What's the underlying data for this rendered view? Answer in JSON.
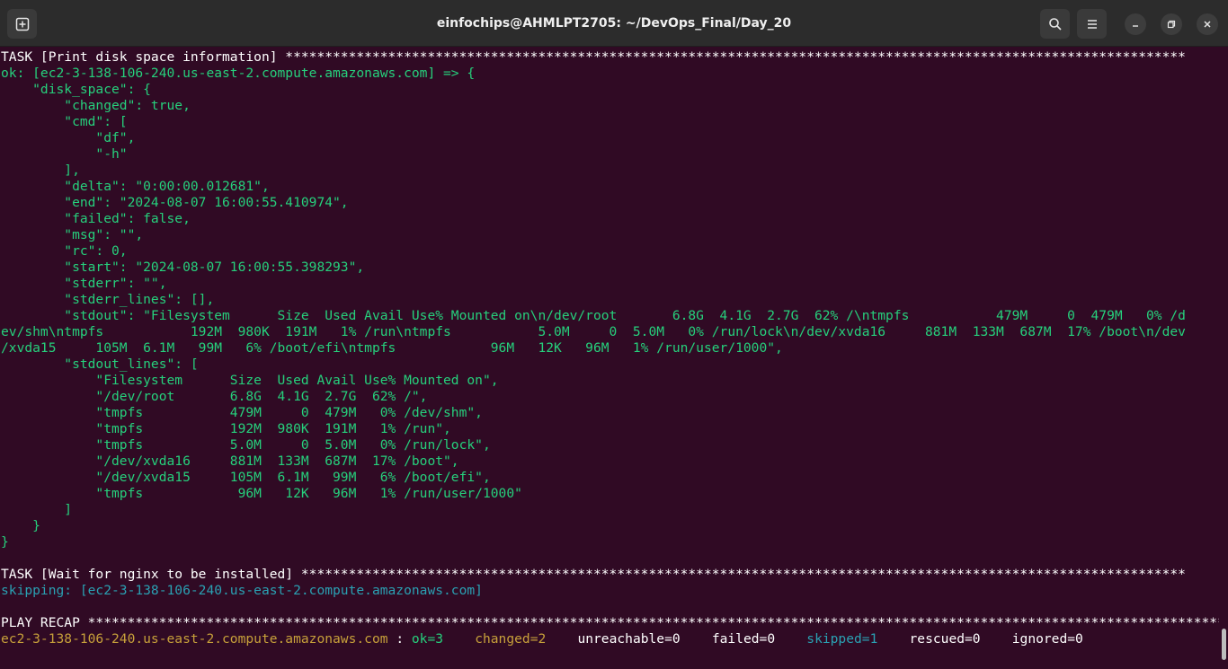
{
  "window": {
    "title": "einfochips@AHMLPT2705: ~/DevOps_Final/Day_20"
  },
  "icons": {
    "new_tab": "new-tab-icon",
    "search": "search-icon",
    "menu": "hamburger-menu-icon",
    "minimize": "minimize-icon",
    "maximize": "maximize-icon",
    "close": "close-icon"
  },
  "colors": {
    "background": "#300a24",
    "ok_text": "#26d07c",
    "skip_text": "#2aa1b3",
    "changed_text": "#c7a03a",
    "plain_text": "#ffffff"
  },
  "terminal": {
    "lines1": [
      {
        "text": "TASK [Print disk space information] ******************************************************************************************************************",
        "color": "white"
      },
      {
        "text": "ok: [ec2-3-138-106-240.us-east-2.compute.amazonaws.com] => {",
        "color": "green"
      },
      {
        "text": "    \"disk_space\": {",
        "color": "green"
      },
      {
        "text": "        \"changed\": true,",
        "color": "green"
      },
      {
        "text": "        \"cmd\": [",
        "color": "green"
      },
      {
        "text": "            \"df\",",
        "color": "green"
      },
      {
        "text": "            \"-h\"",
        "color": "green"
      },
      {
        "text": "        ],",
        "color": "green"
      },
      {
        "text": "        \"delta\": \"0:00:00.012681\",",
        "color": "green"
      },
      {
        "text": "        \"end\": \"2024-08-07 16:00:55.410974\",",
        "color": "green"
      },
      {
        "text": "        \"failed\": false,",
        "color": "green"
      },
      {
        "text": "        \"msg\": \"\",",
        "color": "green"
      },
      {
        "text": "        \"rc\": 0,",
        "color": "green"
      },
      {
        "text": "        \"start\": \"2024-08-07 16:00:55.398293\",",
        "color": "green"
      },
      {
        "text": "        \"stderr\": \"\",",
        "color": "green"
      },
      {
        "text": "        \"stderr_lines\": [],",
        "color": "green"
      },
      {
        "text": "        \"stdout\": \"Filesystem      Size  Used Avail Use% Mounted on\\n/dev/root       6.8G  4.1G  2.7G  62% /\\ntmpfs           479M     0  479M   0% /d",
        "color": "green"
      },
      {
        "text": "ev/shm\\ntmpfs           192M  980K  191M   1% /run\\ntmpfs           5.0M     0  5.0M   0% /run/lock\\n/dev/xvda16     881M  133M  687M  17% /boot\\n/dev",
        "color": "green"
      },
      {
        "text": "/xvda15     105M  6.1M   99M   6% /boot/efi\\ntmpfs            96M   12K   96M   1% /run/user/1000\",",
        "color": "green"
      },
      {
        "text": "        \"stdout_lines\": [",
        "color": "green"
      },
      {
        "text": "            \"Filesystem      Size  Used Avail Use% Mounted on\",",
        "color": "green"
      },
      {
        "text": "            \"/dev/root       6.8G  4.1G  2.7G  62% /\",",
        "color": "green"
      },
      {
        "text": "            \"tmpfs           479M     0  479M   0% /dev/shm\",",
        "color": "green"
      },
      {
        "text": "            \"tmpfs           192M  980K  191M   1% /run\",",
        "color": "green"
      },
      {
        "text": "            \"tmpfs           5.0M     0  5.0M   0% /run/lock\",",
        "color": "green"
      },
      {
        "text": "            \"/dev/xvda16     881M  133M  687M  17% /boot\",",
        "color": "green"
      },
      {
        "text": "            \"/dev/xvda15     105M  6.1M   99M   6% /boot/efi\",",
        "color": "green"
      },
      {
        "text": "            \"tmpfs            96M   12K   96M   1% /run/user/1000\"",
        "color": "green"
      },
      {
        "text": "        ]",
        "color": "green"
      },
      {
        "text": "    }",
        "color": "green"
      },
      {
        "text": "}",
        "color": "green"
      },
      {
        "text": "",
        "color": "white"
      },
      {
        "text": "TASK [Wait for nginx to be installed] ****************************************************************************************************************",
        "color": "white"
      },
      {
        "text": "skipping: [ec2-3-138-106-240.us-east-2.compute.amazonaws.com]",
        "color": "cyan"
      },
      {
        "text": "",
        "color": "white"
      },
      {
        "text": "PLAY RECAP *************************************************************************************************************************************************",
        "color": "white"
      }
    ],
    "recap": {
      "host": "ec2-3-138-106-240.us-east-2.compute.amazonaws.com",
      "sep": " : ",
      "ok": "ok=3",
      "changed": "changed=2",
      "unreachable": "unreachable=0",
      "failed": "failed=0",
      "skipped": "skipped=1",
      "rescued": "rescued=0",
      "ignored": "ignored=0"
    }
  }
}
